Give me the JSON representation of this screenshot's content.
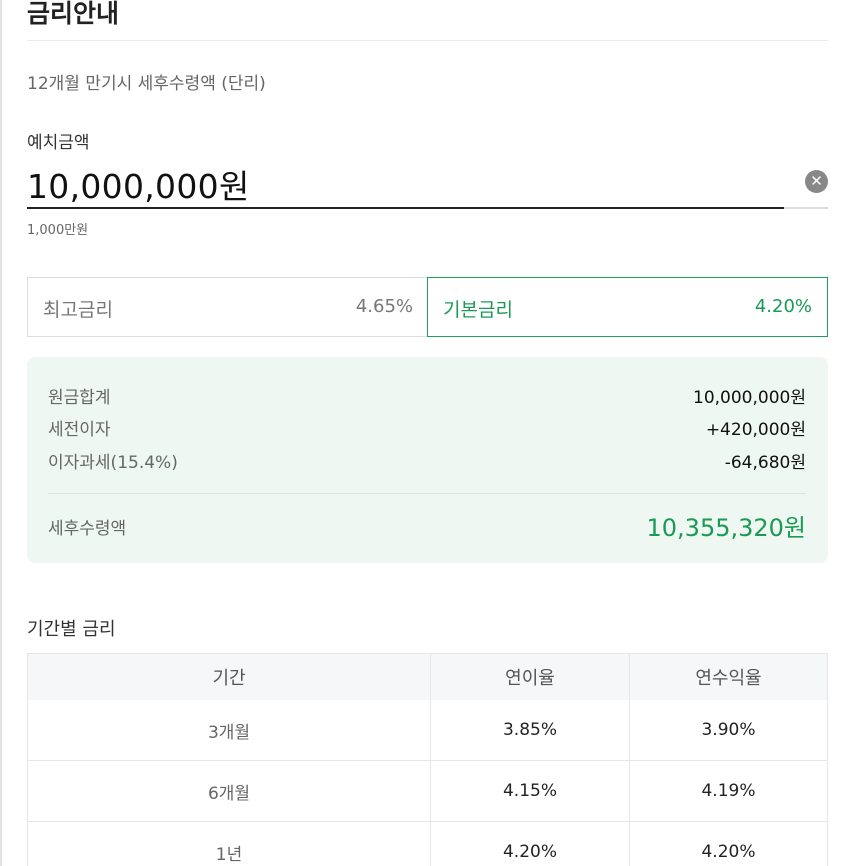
{
  "title": "금리안내",
  "subtitle": "12개월 만기시 세후수령액 (단리)",
  "deposit": {
    "label": "예치금액",
    "value": "10,000,000원",
    "hint": "1,000만원",
    "clear_icon": "close-icon"
  },
  "rate_tabs": [
    {
      "name": "최고금리",
      "value": "4.65%",
      "selected": false
    },
    {
      "name": "기본금리",
      "value": "4.20%",
      "selected": true
    }
  ],
  "summary": {
    "rows": [
      {
        "label": "원금합계",
        "value": "10,000,000원"
      },
      {
        "label": "세전이자",
        "value": "+420,000원"
      },
      {
        "label": "이자과세(15.4%)",
        "value": "-64,680원"
      }
    ],
    "total_label": "세후수령액",
    "total_value": "10,355,320원"
  },
  "period_table": {
    "title": "기간별 금리",
    "headers": [
      "기간",
      "연이율",
      "연수익율"
    ],
    "rows": [
      [
        "3개월",
        "3.85%",
        "3.90%"
      ],
      [
        "6개월",
        "4.15%",
        "4.19%"
      ],
      [
        "1년",
        "4.20%",
        "4.20%"
      ]
    ]
  },
  "colors": {
    "accent_green": "#1a9a55",
    "summary_bg": "#eef7f1"
  }
}
